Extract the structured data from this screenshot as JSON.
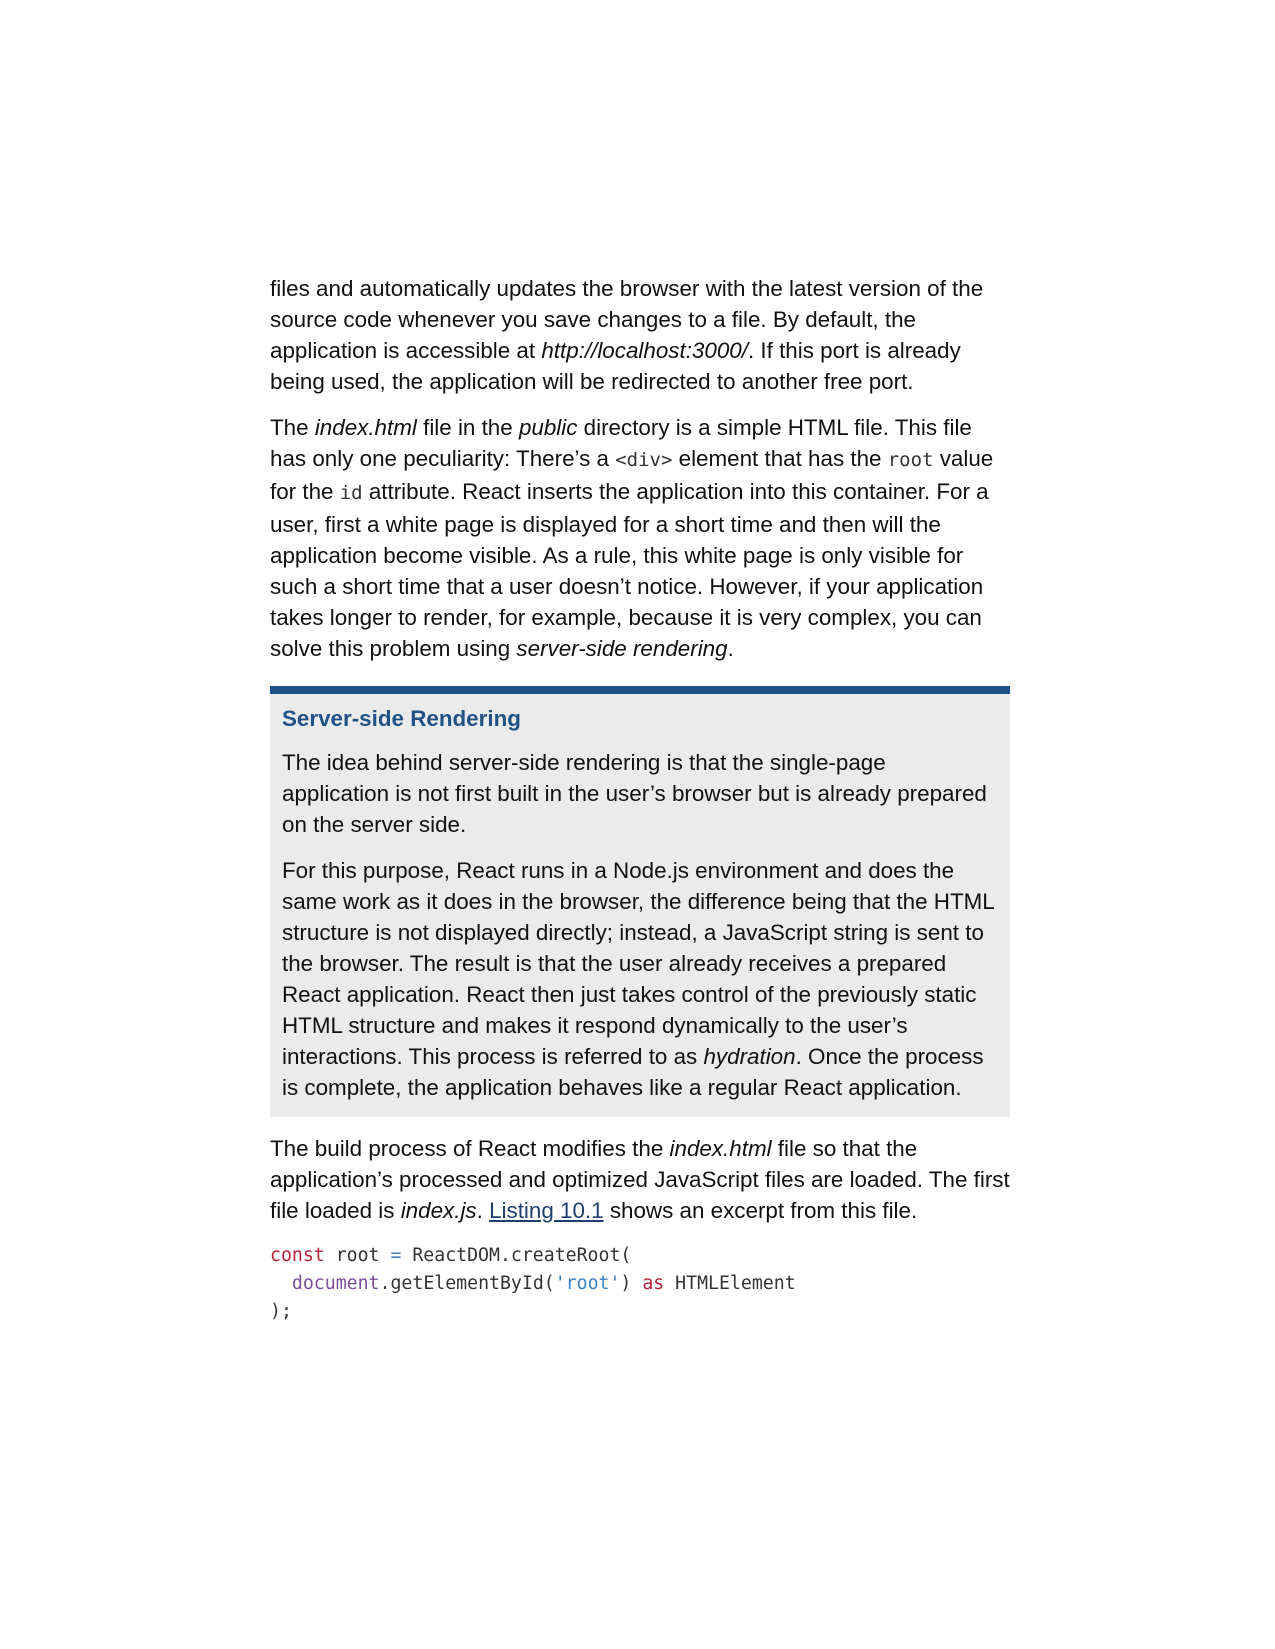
{
  "p1": {
    "t1": "files and automatically updates the browser with the latest version of the source code whenever you save changes to a file. By default, the application is accessible at ",
    "url": "http://localhost:3000/",
    "t2": ". If this port is already being used, the application will be redirected to another free port."
  },
  "p2": {
    "t1": "The ",
    "file": "index.html",
    "t2": " file in the ",
    "dir": "public",
    "t3": " directory is a simple HTML file. This file has only one peculiarity: There’s a ",
    "code1": "<div>",
    "t4": " element that has the ",
    "code2": "root",
    "t5": " value for the ",
    "code3": "id",
    "t6": " attribute. React inserts the application into this container. For a user, first a white page is displayed for a short time and then will the application become visible. As a rule, this white page is only visible for such a short time that a user doesn’t notice. However, if your application takes longer to render, for example, because it is very complex, you can solve this problem using ",
    "term": "server-side rendering",
    "t7": "."
  },
  "box": {
    "title": "Server-side Rendering",
    "p1": "The idea behind server-side rendering is that the single-page application is not first built in the user’s browser but is already prepared on the server side.",
    "p2": {
      "t1": "For this purpose, React runs in a Node.js environment and does the same work as it does in the browser, the difference being that the HTML structure is not displayed directly; instead, a JavaScript string is sent to the browser. The result is that the user already receives a prepared React application. React then just takes control of the previously static HTML structure and makes it respond dynamically to the user’s interactions. This process is referred to as ",
      "term": "hydration",
      "t2": ". Once the process is complete, the application behaves like a regular React application."
    }
  },
  "p3": {
    "t1": "The build process of React modifies the ",
    "file": "index.html",
    "t2": " file so that the application’s processed and optimized JavaScript files are loaded. The first file loaded is ",
    "file2": "index.js",
    "t3": ". ",
    "link": "Listing 10.1",
    "t4": " shows an excerpt from this file."
  },
  "code": {
    "l1_kw": "const",
    "l1_a": " root ",
    "l1_op": "=",
    "l1_b": " ReactDOM.createRoot(",
    "l2_indent": "  ",
    "l2_obj": "document",
    "l2_a": ".getElementById(",
    "l2_str": "'root'",
    "l2_b": ") ",
    "l2_kw": "as",
    "l2_c": " HTMLElement",
    "l3": ");"
  },
  "colors": {
    "accent": "#1f5287",
    "box_background": "#ebebeb",
    "keyword": "#b2233a",
    "string": "#3c7fbf",
    "object": "#7a4f9a"
  }
}
